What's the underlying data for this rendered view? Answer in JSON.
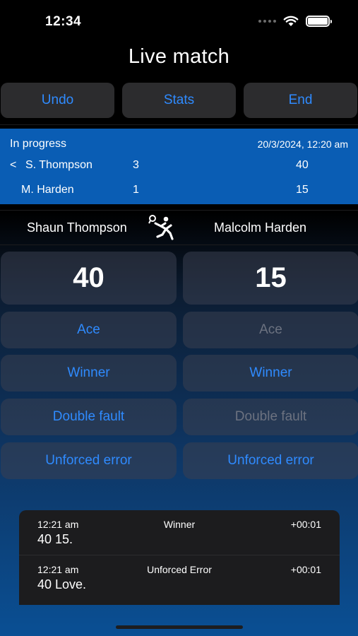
{
  "status_bar": {
    "time": "12:34",
    "icons": [
      "signal-dots-icon",
      "wifi-icon",
      "battery-icon"
    ]
  },
  "nav": {
    "title": "Live match"
  },
  "toolbar": {
    "undo_label": "Undo",
    "stats_label": "Stats",
    "end_label": "End"
  },
  "scoreboard": {
    "status": "In progress",
    "datetime": "20/3/2024, 12:20 am",
    "serve_marker": "<",
    "rows": [
      {
        "name": "S. Thompson",
        "games": "3",
        "points": "40"
      },
      {
        "name": "M. Harden",
        "games": "1",
        "points": "15"
      }
    ]
  },
  "players": {
    "left": {
      "name": "Shaun Thompson",
      "serving_icon": "tennis-player-icon"
    },
    "right": {
      "name": "Malcolm Harden"
    }
  },
  "score_cards": {
    "left": {
      "points": "40",
      "ace": "Ace",
      "winner": "Winner",
      "double_fault": "Double fault",
      "unforced_error": "Unforced error"
    },
    "right": {
      "points": "15",
      "ace": "Ace",
      "winner": "Winner",
      "double_fault": "Double fault",
      "unforced_error": "Unforced error"
    }
  },
  "log": [
    {
      "time": "12:21 am",
      "event": "Winner",
      "delta": "+00:01",
      "score": "40 15."
    },
    {
      "time": "12:21 am",
      "event": "Unforced Error",
      "delta": "+00:01",
      "score": "40 Love."
    }
  ],
  "colors": {
    "accent": "#2f8bff",
    "banner": "#0a5db4",
    "disabled": "#6c7280"
  }
}
